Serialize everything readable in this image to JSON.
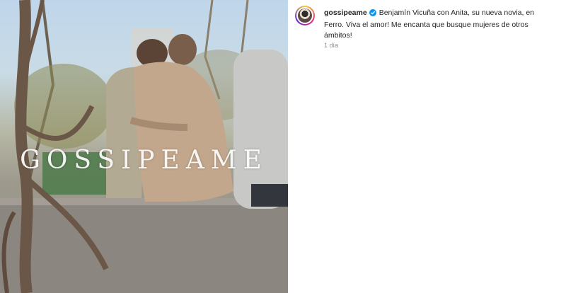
{
  "post": {
    "username": "gossipeame",
    "caption": "Benjamín Vicuña con Anita, su nueva novia, en Ferro. Viva el amor! Me encanta que busque mujeres de otros ámbitos!",
    "timestamp": "1 día",
    "watermark": "GOSSIPEAME"
  },
  "icons": {
    "verified": "verified-badge-icon"
  },
  "colors": {
    "verified_blue": "#0095f6",
    "text": "#262626",
    "muted": "#8e8e8e"
  }
}
